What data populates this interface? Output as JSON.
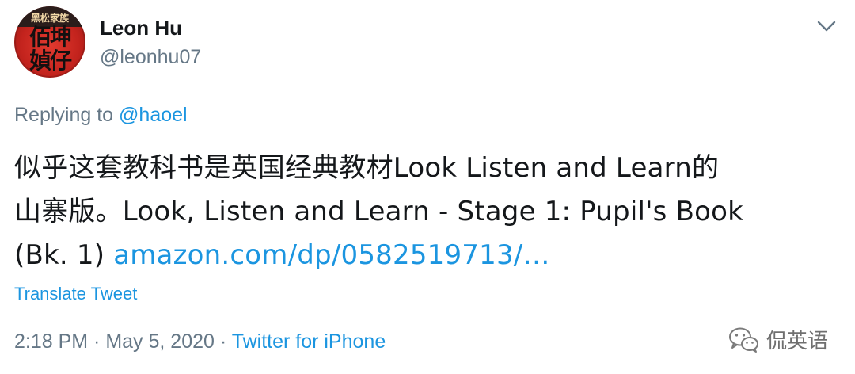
{
  "user": {
    "display_name": "Leon Hu",
    "handle": "@leonhu07",
    "avatar_band_text": "黑松家族",
    "avatar_text": "佰坤媜仔"
  },
  "reply": {
    "prefix": "Replying to ",
    "mention": "@haoel"
  },
  "tweet": {
    "line1": "似乎这套教科书是英国经典教材Look Listen and Learn的",
    "line2": "山寨版。Look, Listen and Learn - Stage 1: Pupil's Book",
    "line3_prefix": "(Bk. 1) ",
    "link_text": "amazon.com/dp/0582519713/…"
  },
  "translate_label": "Translate Tweet",
  "meta": {
    "time": "2:18 PM",
    "sep1": " · ",
    "date": "May 5, 2020",
    "sep2": " · ",
    "source": "Twitter for iPhone"
  },
  "watermark": {
    "text": "侃英语",
    "icon": "wechat-icon"
  },
  "colors": {
    "link": "#1b95e0",
    "muted": "#657786",
    "text": "#14171a"
  }
}
